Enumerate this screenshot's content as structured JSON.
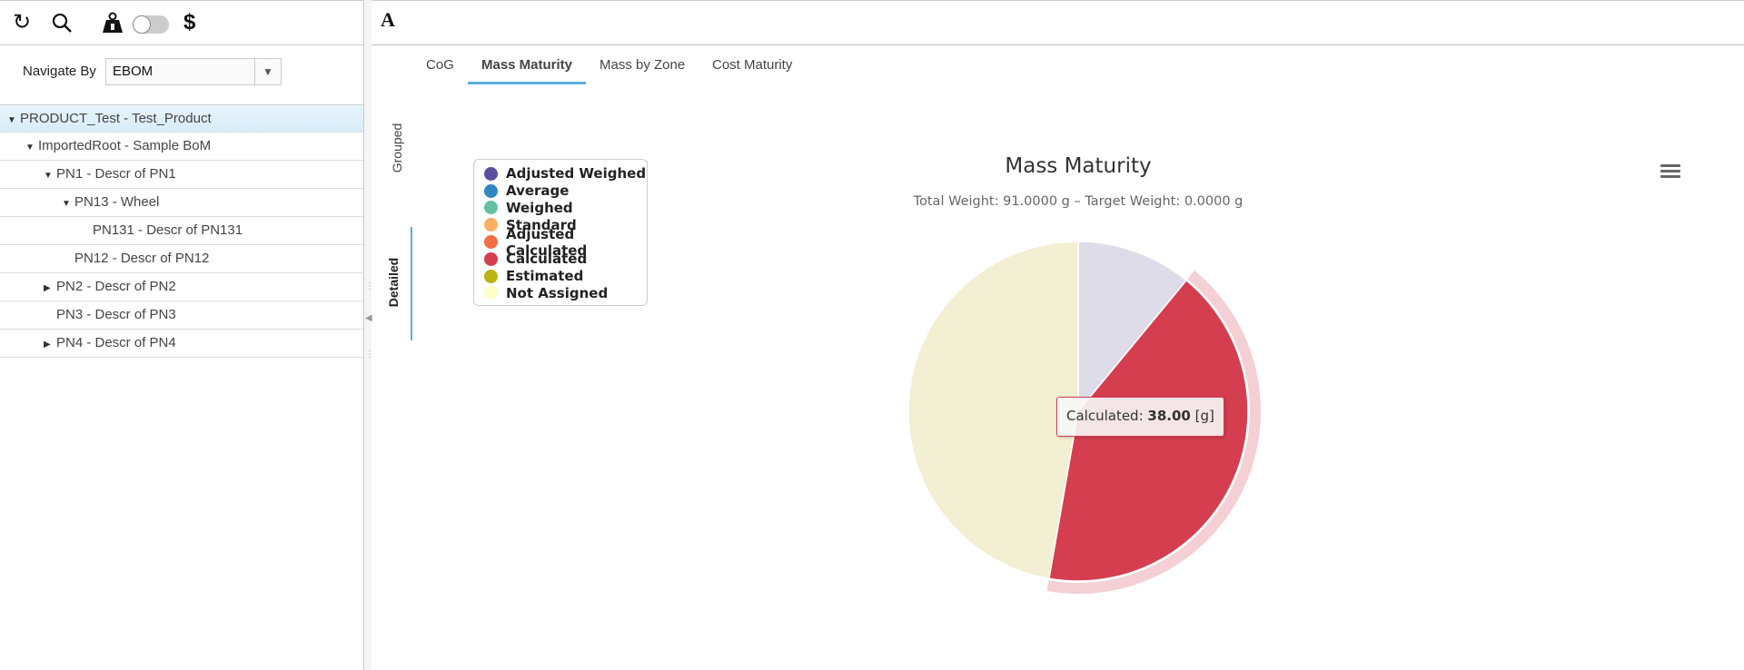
{
  "toolbar": {
    "icons": [
      "refresh-icon",
      "search-icon",
      "weight-lock-icon",
      "toggle",
      "dollar-icon"
    ],
    "refresh": "↻",
    "search": "⚲",
    "weight": "⚿",
    "dollar": "$"
  },
  "navigate": {
    "label": "Navigate By",
    "value": "EBOM"
  },
  "tree": [
    {
      "label": "PRODUCT_Test - Test_Product",
      "level": 0,
      "state": "expanded",
      "selected": true
    },
    {
      "label": "ImportedRoot - Sample BoM",
      "level": 1,
      "state": "expanded"
    },
    {
      "label": "PN1 - Descr of PN1",
      "level": 2,
      "state": "expanded"
    },
    {
      "label": "PN13 - Wheel",
      "level": 3,
      "state": "expanded"
    },
    {
      "label": "PN131 - Descr of PN131",
      "level": 4,
      "state": "leaf"
    },
    {
      "label": "PN12 - Descr of PN12",
      "level": 3,
      "state": "leaf"
    },
    {
      "label": "PN2 - Descr of PN2",
      "level": 2,
      "state": "collapsed"
    },
    {
      "label": "PN3 - Descr of PN3",
      "level": 2,
      "state": "leaf"
    },
    {
      "label": "PN4 - Descr of PN4",
      "level": 2,
      "state": "collapsed"
    }
  ],
  "header": {
    "logo": "A"
  },
  "tabs": [
    {
      "label": "CoG"
    },
    {
      "label": "Mass Maturity",
      "active": true
    },
    {
      "label": "Mass by Zone"
    },
    {
      "label": "Cost Maturity"
    }
  ],
  "side_tabs": [
    {
      "label": "Grouped"
    },
    {
      "label": "Detailed",
      "active": true
    }
  ],
  "chart_data": {
    "type": "pie",
    "title": "Mass Maturity",
    "subtitle": "Total Weight: 91.0000 g – Target Weight: 0.0000 g",
    "legend_position": "top-left",
    "legend": [
      {
        "name": "Adjusted Weighed",
        "color": "#5b4ea0"
      },
      {
        "name": "Average",
        "color": "#2f86c0"
      },
      {
        "name": "Weighed",
        "color": "#62c2a2"
      },
      {
        "name": "Standard",
        "color": "#fdae61"
      },
      {
        "name": "Adjusted Calculated",
        "color": "#f46d43"
      },
      {
        "name": "Calculated",
        "color": "#d53e4f"
      },
      {
        "name": "Estimated",
        "color": "#bcb314"
      },
      {
        "name": "Not Assigned",
        "color": "#ffffc8"
      }
    ],
    "slices": [
      {
        "name": "Adjusted Weighed",
        "value": 10,
        "color": "#dfdcea"
      },
      {
        "name": "Calculated",
        "value": 38,
        "color": "#d53e4f",
        "hovered": true
      },
      {
        "name": "Not Assigned",
        "value": 43,
        "color": "#f2efd2"
      }
    ],
    "unit": "g",
    "tooltip": {
      "label": "Calculated: ",
      "value": "38.00",
      "unit": " [g]"
    }
  }
}
